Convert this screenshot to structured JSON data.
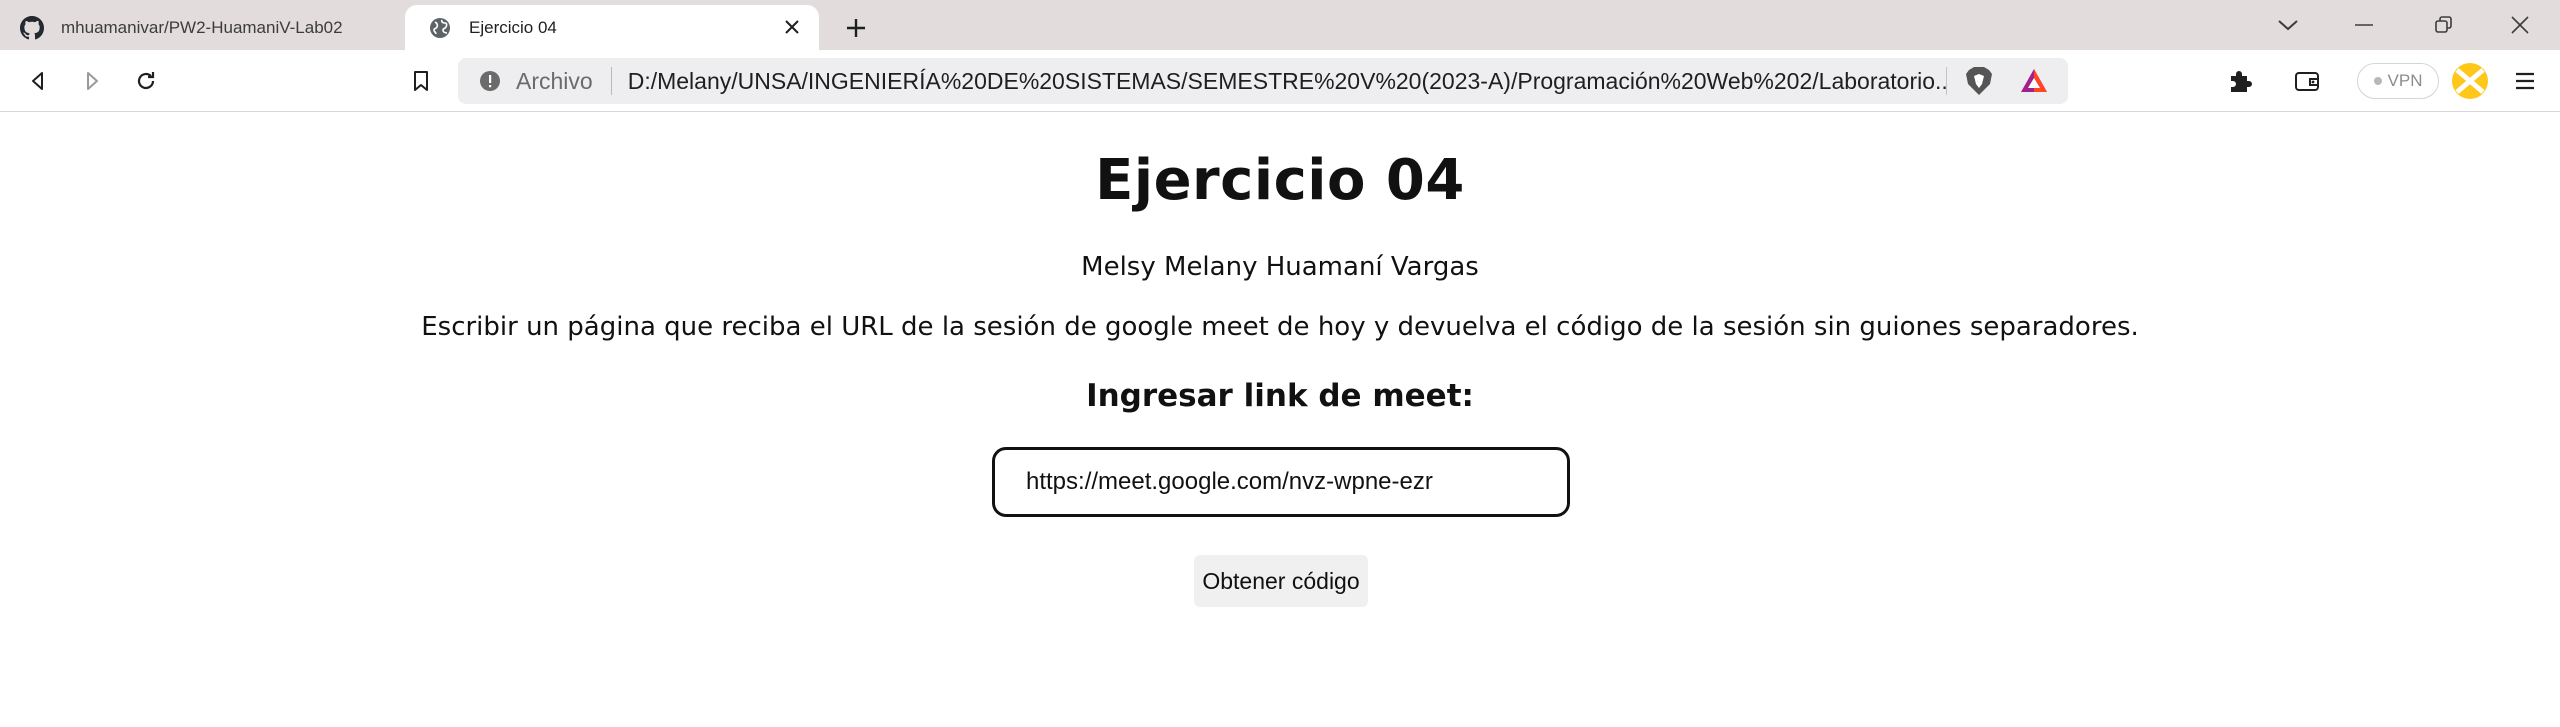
{
  "browser": {
    "tabs": [
      {
        "title": "mhuamanivar/PW2-HuamaniV-Lab02",
        "icon": "github-icon",
        "active": false
      },
      {
        "title": "Ejercicio 04",
        "icon": "globe-icon",
        "active": true
      }
    ],
    "address_bar": {
      "scheme_label": "Archivo",
      "url": "D:/Melany/UNSA/INGENIERÍA%20DE%20SISTEMAS/SEMESTRE%20V%20(2023-A)/Programación%20Web%202/Laboratorio..."
    },
    "vpn_label": "VPN"
  },
  "page": {
    "heading": "Ejercicio 04",
    "author": "Melsy Melany Huamaní Vargas",
    "description": "Escribir un página que reciba el URL de la sesión de google meet de hoy y devuelva el código de la sesión sin guiones separadores.",
    "input_label": "Ingresar link de meet:",
    "input_value": "https://meet.google.com/nvz-wpne-ezr",
    "button_label": "Obtener código"
  },
  "colors": {
    "tabstrip_bg": "#e2dcdc",
    "omnibox_bg": "#eeeef0",
    "button_bg": "#f0f0f0",
    "brave_orange": "#fb542b"
  }
}
